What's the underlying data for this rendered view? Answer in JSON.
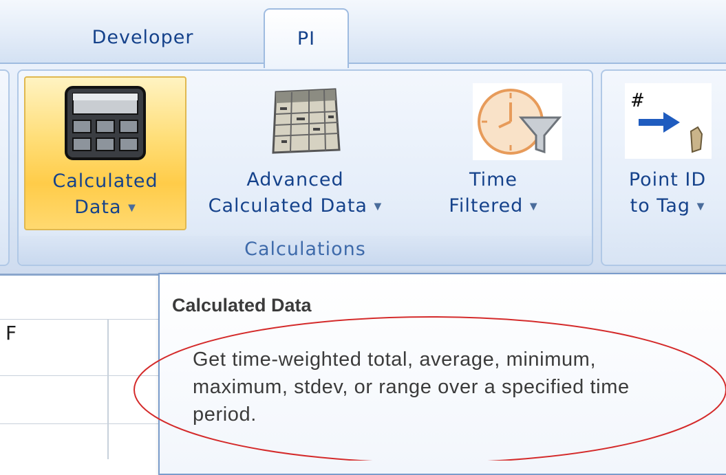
{
  "tabs": [
    {
      "label": "Developer"
    },
    {
      "label": "PI",
      "selected": true
    }
  ],
  "ribbon": {
    "groups": [
      {
        "label": "Calculations",
        "buttons": [
          {
            "line1": "Calculated",
            "line2": "Data",
            "icon": "calculator-icon",
            "highlighted": true
          },
          {
            "line1": "Advanced",
            "line2": "Calculated Data",
            "icon": "spreadsheet-icon"
          },
          {
            "line1": "Time",
            "line2": "Filtered",
            "icon": "clock-filter-icon"
          }
        ]
      },
      {
        "buttons": [
          {
            "line1": "Point ID",
            "line2": "to Tag",
            "icon": "point-id-to-tag-icon"
          }
        ]
      }
    ]
  },
  "sheet": {
    "column_header": "F"
  },
  "tooltip": {
    "title": "Calculated Data",
    "body": "Get time-weighted total, average, minimum, maximum, stdev, or range over a specified time period."
  },
  "colors": {
    "tab_text": "#15428b",
    "highlight": "#ffd56b",
    "annotation": "#d42a2a"
  }
}
